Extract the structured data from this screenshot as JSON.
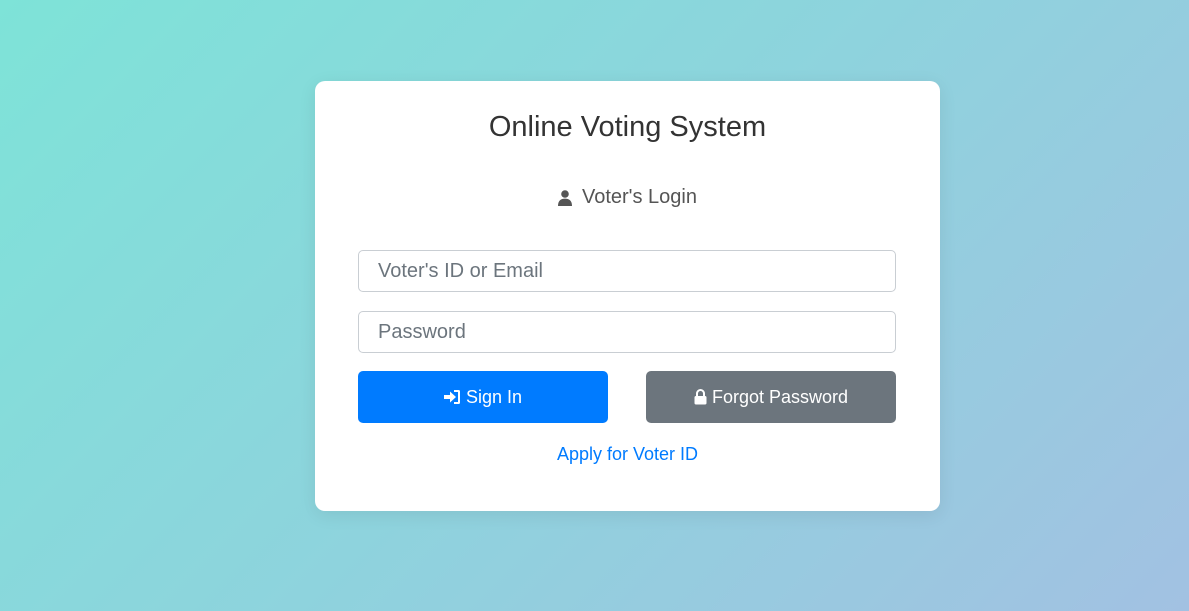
{
  "header": {
    "title": "Online Voting System",
    "subtitle": "Voter's Login"
  },
  "form": {
    "id_field": {
      "placeholder": "Voter's ID or Email",
      "value": ""
    },
    "password_field": {
      "placeholder": "Password",
      "value": ""
    }
  },
  "actions": {
    "signin_label": "Sign In",
    "forgot_label": "Forgot Password",
    "apply_link": "Apply for Voter ID"
  },
  "icons": {
    "subtitle": "user-icon",
    "signin": "sign-in-icon",
    "forgot": "lock-icon"
  },
  "colors": {
    "primary": "#007bff",
    "secondary": "#6c757d",
    "card": "#ffffff"
  }
}
